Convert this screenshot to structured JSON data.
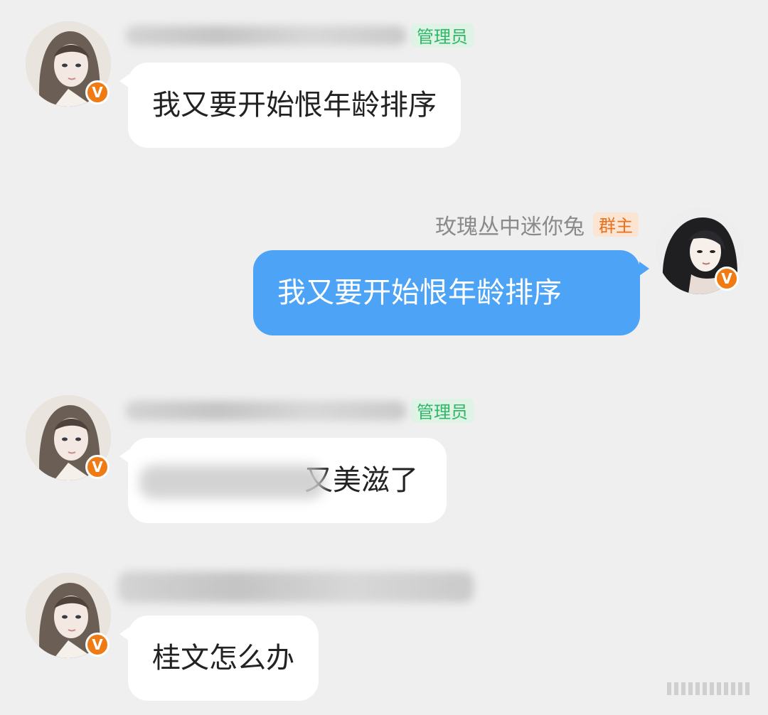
{
  "messages": [
    {
      "side": "left",
      "sender_role": "管理员",
      "text": "我又要开始恨年龄排序",
      "badge": "V"
    },
    {
      "side": "right",
      "sender_name": "玫瑰丛中迷你兔",
      "sender_role": "群主",
      "text": "我又要开始恨年龄排序",
      "badge": "V"
    },
    {
      "side": "left",
      "sender_role": "管理员",
      "text": "又美滋了",
      "badge": "V"
    },
    {
      "side": "left",
      "sender_role": "",
      "text": "桂文怎么办",
      "badge": "V"
    }
  ],
  "colors": {
    "background": "#efefef",
    "left_bubble": "#ffffff",
    "right_bubble": "#4da3f5",
    "admin_tag_bg": "#dff3e6",
    "admin_tag_text": "#2fb765",
    "owner_tag_bg": "#fbe5d2",
    "owner_tag_text": "#e8711d",
    "v_badge": "#f07a13"
  },
  "icons": {
    "avatar": "user-avatar-illustration",
    "badge": "vip-v-badge-icon"
  }
}
